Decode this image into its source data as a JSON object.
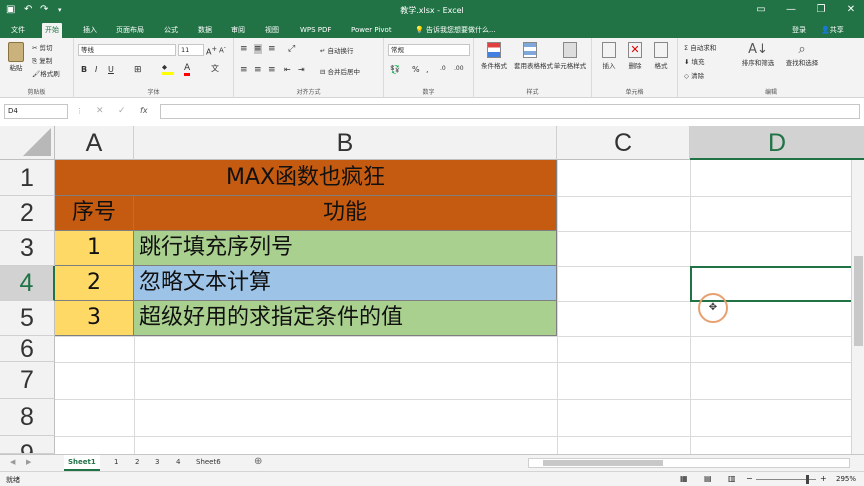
{
  "window": {
    "title": "教学.xlsx - Excel",
    "login": "登录",
    "share": "共享"
  },
  "tabs": [
    "文件",
    "开始",
    "插入",
    "页面布局",
    "公式",
    "数据",
    "审阅",
    "视图",
    "WPS PDF",
    "Power Pivot"
  ],
  "tellme": "告诉我您想要做什么...",
  "ribbon": {
    "clipboard": {
      "paste": "粘贴",
      "cut": "剪切",
      "copy": "复制",
      "format_painter": "格式刷",
      "label": "剪贴板"
    },
    "font": {
      "name": "等线",
      "size": "11",
      "label": "字体",
      "bold": "B",
      "italic": "I",
      "underline": "U"
    },
    "alignment": {
      "wrap": "自动换行",
      "merge": "合并后居中",
      "label": "对齐方式"
    },
    "number": {
      "format": "常规",
      "label": "数字",
      "percent": "%"
    },
    "styles": {
      "conditional": "条件格式",
      "table_format": "套用表格格式",
      "cell_styles": "单元格样式",
      "label": "样式"
    },
    "cells": {
      "insert": "插入",
      "delete": "删除",
      "format": "格式",
      "label": "单元格"
    },
    "editing": {
      "autosum": "自动求和",
      "fill": "填充",
      "clear": "清除",
      "sort": "排序和筛选",
      "find": "查找和选择",
      "label": "编辑"
    }
  },
  "formula_bar": {
    "name_box": "D4",
    "fx": "fx",
    "formula": ""
  },
  "columns": [
    "A",
    "B",
    "C",
    "D"
  ],
  "rows": [
    "1",
    "2",
    "3",
    "4",
    "5",
    "6",
    "7",
    "8",
    "9"
  ],
  "cells": {
    "title": "MAX函数也疯狂",
    "header_a": "序号",
    "header_b": "功能",
    "r3a": "1",
    "r3b": "跳行填充序列号",
    "r4a": "2",
    "r4b": "忽略文本计算",
    "r5a": "3",
    "r5b": "超级好用的求指定条件的值"
  },
  "colors": {
    "orange": "#c55a11",
    "yellow": "#ffd966",
    "green": "#a9d08e",
    "blue": "#9dc3e6",
    "excel_green": "#217346"
  },
  "sheets": [
    "Sheet1",
    "1",
    "2",
    "3",
    "4",
    "Sheet6"
  ],
  "status": {
    "ready": "就绪",
    "zoom": "295%"
  }
}
